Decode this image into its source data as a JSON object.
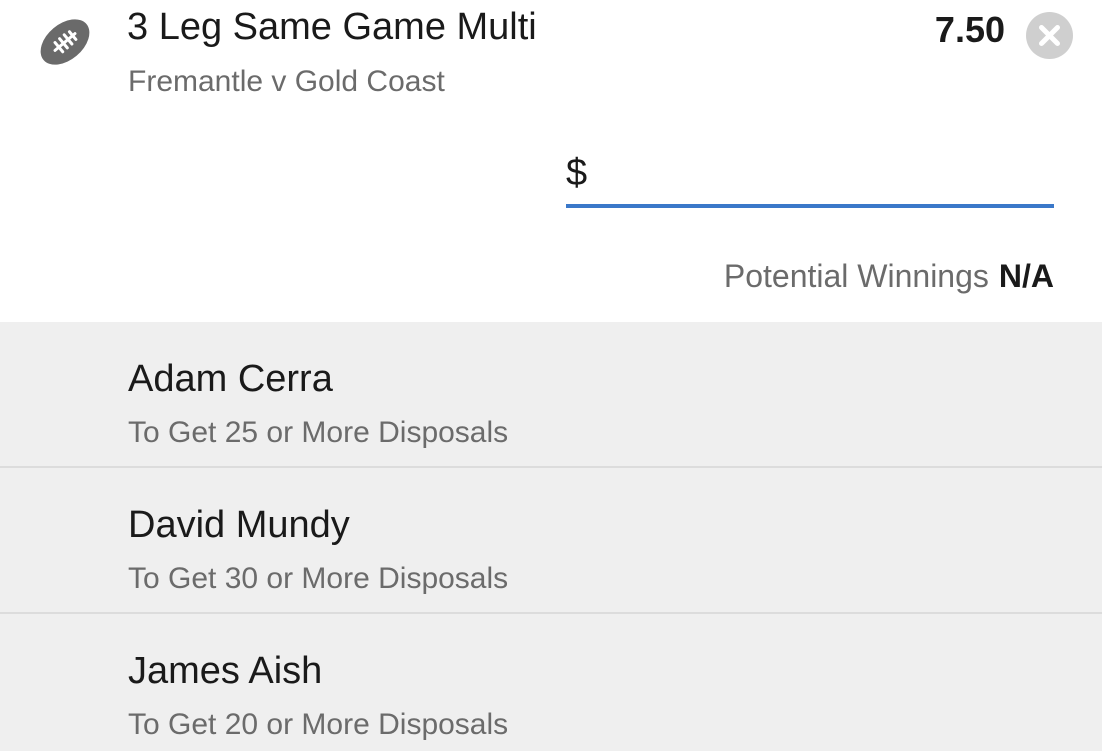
{
  "bet": {
    "icon": "football-icon",
    "title": "3 Leg Same Game Multi",
    "match": "Fremantle v Gold Coast",
    "odds": "7.50",
    "remove_icon": "close-circle-icon"
  },
  "stake": {
    "prefix": "$",
    "value": "",
    "placeholder": ""
  },
  "winnings": {
    "label": "Potential Winnings",
    "value": "N/A"
  },
  "legs": [
    {
      "name": "Adam Cerra",
      "market": "To Get 25 or More Disposals"
    },
    {
      "name": "David Mundy",
      "market": "To Get 30 or More Disposals"
    },
    {
      "name": "James Aish",
      "market": "To Get 20 or More Disposals"
    }
  ],
  "colors": {
    "accent": "#3a78c9",
    "icon_grey": "#6a6a6a",
    "close_grey": "#cfcfcf",
    "legs_bg": "#efefef"
  }
}
